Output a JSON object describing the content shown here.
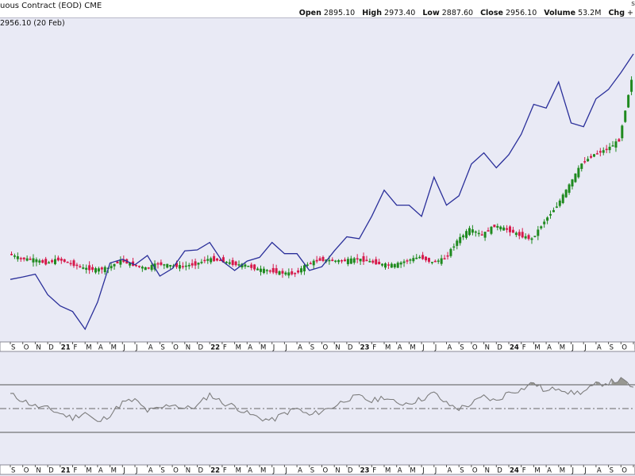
{
  "header": {
    "title": "uous Contract (EOD) CME",
    "corner": "s",
    "open_label": "Open",
    "open": "2895.10",
    "high_label": "High",
    "high": "2973.40",
    "low_label": "Low",
    "low": "2887.60",
    "close_label": "Close",
    "close": "2956.10",
    "volume_label": "Volume",
    "volume": "53.2M",
    "chg_label": "Chg",
    "chg": "+"
  },
  "last_label": "2956.10 (20 Feb)",
  "colors": {
    "up": "#1f8a1f",
    "down": "#d6194b",
    "overlay": "#2a2f9a",
    "rsi": "#7d7d7d",
    "rsi_fill": "#8a8a80",
    "panel_bg": "#e9eaf5"
  },
  "chart_data": [
    {
      "type": "candlestick",
      "title": "",
      "x": [
        "S",
        "O",
        "N",
        "D",
        "21",
        "F",
        "M",
        "A",
        "M",
        "J",
        "J",
        "A",
        "S",
        "O",
        "N",
        "D",
        "22",
        "F",
        "M",
        "A",
        "M",
        "J",
        "J",
        "A",
        "S",
        "O",
        "N",
        "D",
        "23",
        "F",
        "M",
        "A",
        "M",
        "J",
        "J",
        "A",
        "S",
        "O",
        "N",
        "D",
        "24",
        "F",
        "M",
        "A",
        "M",
        "J",
        "J",
        "A",
        "S",
        "O",
        "N"
      ],
      "bold_ticks": [
        "21",
        "22",
        "23",
        "24"
      ],
      "grid": false,
      "series": [
        {
          "values": [
            1918,
            1890,
            1885,
            1864,
            1886,
            1862,
            1835,
            1827,
            1836,
            1880,
            1854,
            1834,
            1860,
            1850,
            1846,
            1858,
            1887,
            1880,
            1860,
            1852,
            1828,
            1820,
            1807,
            1803,
            1860,
            1884,
            1878,
            1878,
            1888,
            1873,
            1856,
            1853,
            1880,
            1900,
            1868,
            1890,
            1993,
            2060,
            2026,
            2080,
            2058,
            2026,
            2003,
            2107,
            2196,
            2314,
            2440,
            2494,
            2522,
            2575,
            2930
          ]
        },
        {
          "values": [
            1782,
            1795,
            1810,
            1700,
            1640,
            1610,
            1515,
            1660,
            1870,
            1890,
            1860,
            1910,
            1800,
            1840,
            1935,
            1940,
            1980,
            1880,
            1830,
            1880,
            1900,
            1980,
            1920,
            1920,
            1830,
            1850,
            1935,
            2010,
            2000,
            2120,
            2260,
            2180,
            2180,
            2120,
            2330,
            2180,
            2230,
            2400,
            2460,
            2380,
            2450,
            2560,
            2720,
            2700,
            2840,
            2620,
            2600,
            2750,
            2800,
            2890,
            2990
          ]
        }
      ]
    },
    {
      "type": "line",
      "title": "",
      "x": [
        "S",
        "O",
        "N",
        "D",
        "21",
        "F",
        "M",
        "A",
        "M",
        "J",
        "J",
        "A",
        "S",
        "O",
        "N",
        "D",
        "22",
        "F",
        "M",
        "A",
        "M",
        "J",
        "J",
        "A",
        "S",
        "O",
        "N",
        "D",
        "23",
        "F",
        "M",
        "A",
        "M",
        "J",
        "J",
        "A",
        "S",
        "O",
        "N",
        "D",
        "24",
        "F",
        "M",
        "A",
        "M",
        "J",
        "J",
        "A",
        "S",
        "O",
        "N"
      ],
      "bold_ticks": [
        "21",
        "22",
        "23",
        "24"
      ],
      "reference_lines": [
        70,
        50,
        30
      ],
      "ylim": [
        20,
        80
      ],
      "series": [
        {
          "values": [
            62,
            57,
            52,
            50,
            46,
            42,
            47,
            38,
            45,
            55,
            57,
            48,
            50,
            54,
            50,
            52,
            62,
            55,
            52,
            46,
            42,
            40,
            46,
            50,
            44,
            48,
            52,
            58,
            60,
            56,
            60,
            54,
            55,
            58,
            63,
            54,
            50,
            54,
            60,
            56,
            64,
            66,
            72,
            64,
            68,
            63,
            64,
            70,
            72,
            74,
            68
          ]
        }
      ]
    }
  ]
}
